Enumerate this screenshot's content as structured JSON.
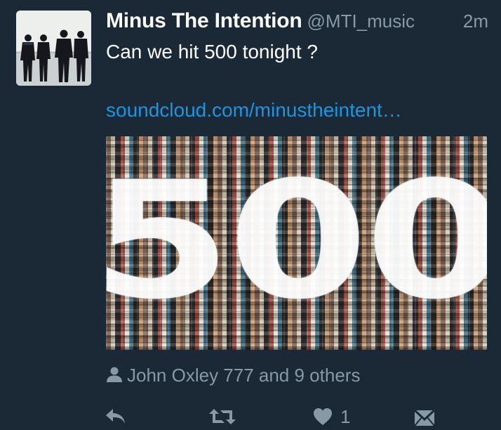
{
  "tweet": {
    "author_name": "Minus The Intention",
    "handle": "@MTI_music",
    "time": "2m",
    "text": "Can we hit 500 tonight ?",
    "link": "soundcloud.com/minustheintent…",
    "media_text": "500",
    "liked_by": "John Oxley 777 and 9 others",
    "like_count": "1"
  },
  "icons": {
    "liked_by": "person-icon",
    "reply": "reply-icon",
    "retweet": "retweet-icon",
    "like": "heart-icon",
    "direct_message": "direct-message-icon"
  },
  "colors": {
    "background": "#1b2836",
    "link": "#1b95e0",
    "secondary_text": "#8899a6"
  }
}
